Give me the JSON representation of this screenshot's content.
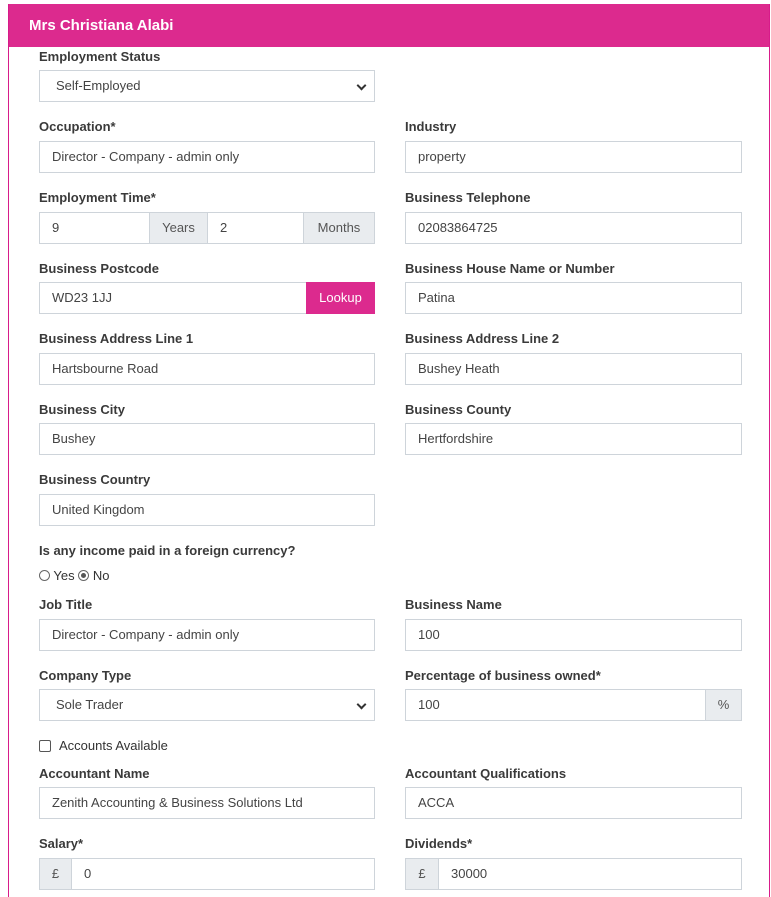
{
  "header": {
    "title": "Mrs Christiana Alabi"
  },
  "employment_status": {
    "label": "Employment Status",
    "value": "Self-Employed"
  },
  "occupation": {
    "label": "Occupation*",
    "value": "Director - Company - admin only"
  },
  "industry": {
    "label": "Industry",
    "value": "property"
  },
  "employment_time": {
    "label": "Employment Time*",
    "years_value": "9",
    "years_addon": "Years",
    "months_value": "2",
    "months_addon": "Months"
  },
  "business_telephone": {
    "label": "Business Telephone",
    "value": "02083864725"
  },
  "business_postcode": {
    "label": "Business Postcode",
    "value": "WD23 1JJ",
    "lookup_label": "Lookup"
  },
  "business_house": {
    "label": "Business House Name or Number",
    "value": "Patina"
  },
  "address_line1": {
    "label": "Business Address Line 1",
    "value": "Hartsbourne Road"
  },
  "address_line2": {
    "label": "Business Address Line 2",
    "value": "Bushey Heath"
  },
  "city": {
    "label": "Business City",
    "value": "Bushey"
  },
  "county": {
    "label": "Business County",
    "value": "Hertfordshire"
  },
  "country": {
    "label": "Business Country",
    "value": "United Kingdom"
  },
  "foreign_currency": {
    "label": "Is any income paid in a foreign currency?",
    "yes_label": "Yes",
    "no_label": "No",
    "selected": "No"
  },
  "job_title": {
    "label": "Job Title",
    "value": "Director - Company - admin only"
  },
  "business_name": {
    "label": "Business Name",
    "value": "100"
  },
  "company_type": {
    "label": "Company Type",
    "value": "Sole Trader"
  },
  "percentage_owned": {
    "label": "Percentage of business owned*",
    "value": "100",
    "addon": "%"
  },
  "accounts_available": {
    "label": "Accounts Available",
    "checked": false
  },
  "accountant_name": {
    "label": "Accountant Name",
    "value": "Zenith Accounting & Business Solutions Ltd"
  },
  "accountant_qualifications": {
    "label": "Accountant Qualifications",
    "value": "ACCA"
  },
  "salary": {
    "label": "Salary*",
    "currency": "£",
    "value": "0"
  },
  "dividends": {
    "label": "Dividends*",
    "currency": "£",
    "value": "30000"
  },
  "colors": {
    "accent": "#dc2a8e",
    "addon_bg": "#e9ecef",
    "border": "#ced4da"
  }
}
